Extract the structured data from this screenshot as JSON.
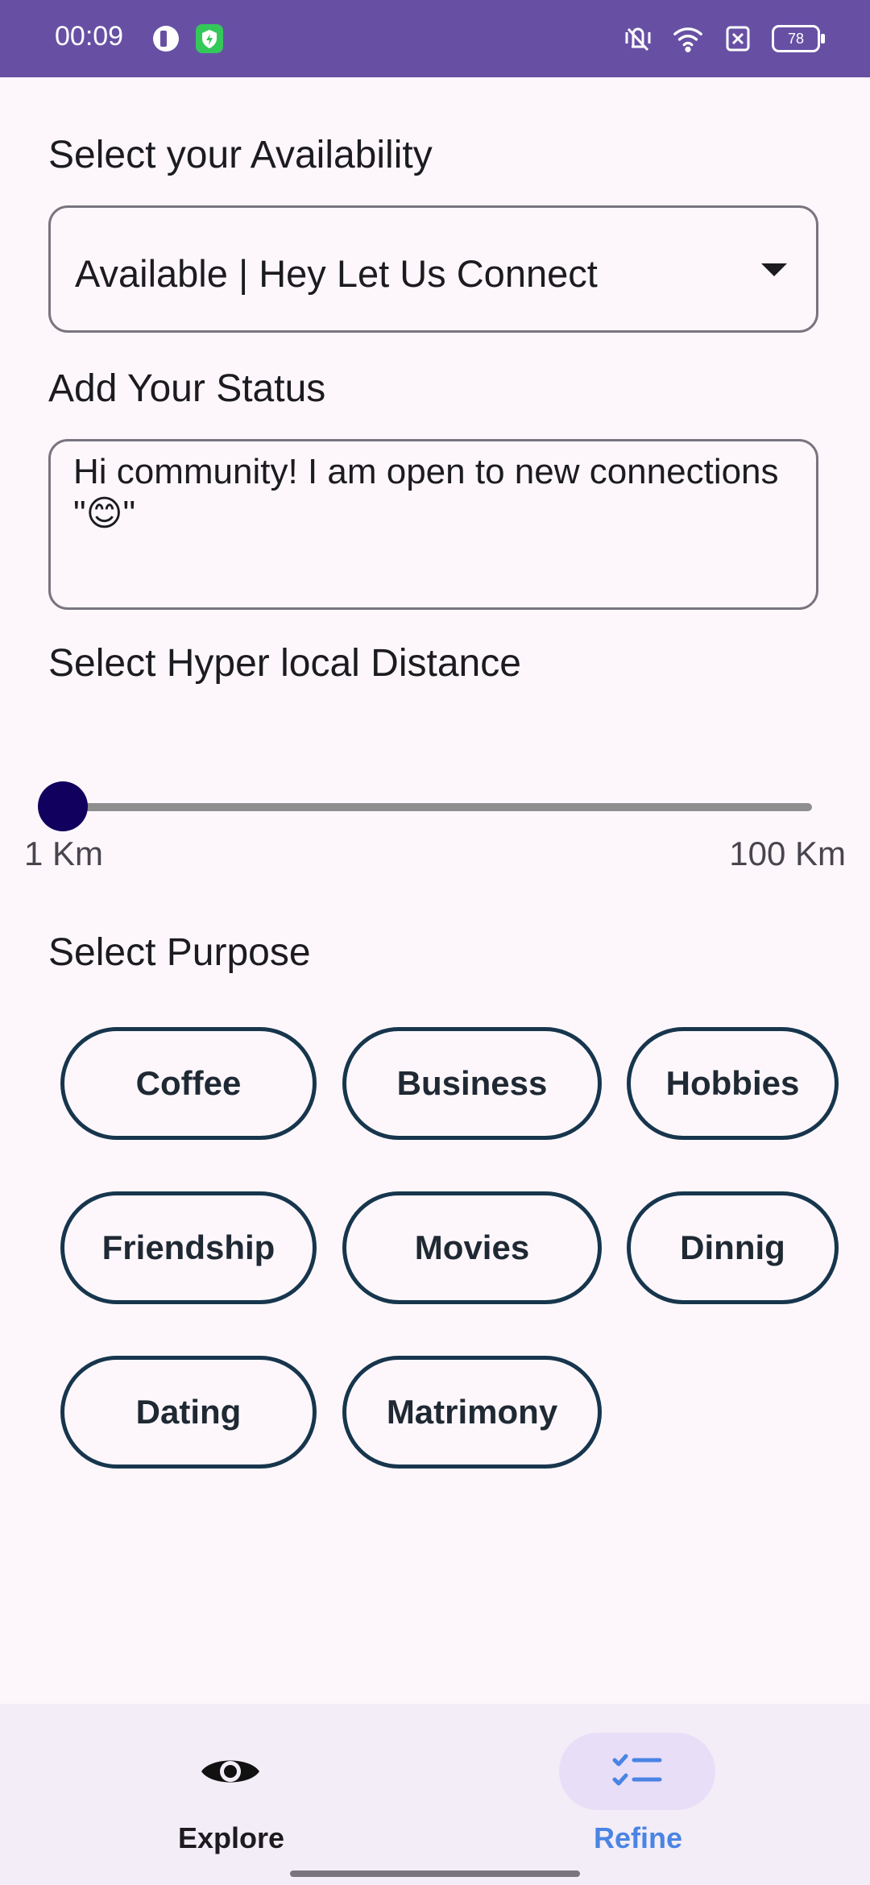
{
  "status_bar": {
    "time": "00:09",
    "battery": "78"
  },
  "form": {
    "availability_label": "Select your Availability",
    "availability_value": "Available | Hey Let Us Connect",
    "status_label": "Add Your Status",
    "status_value": "Hi community! I am open to new connections \"😊\"",
    "distance_label": "Select Hyper local Distance",
    "distance_min": "1 Km",
    "distance_max": "100 Km",
    "distance_value_fraction": 0.0,
    "purpose_label": "Select Purpose",
    "purposes": [
      "Coffee",
      "Business",
      "Hobbies",
      "Friendship",
      "Movies",
      "Dinnig",
      "Dating",
      "Matrimony"
    ]
  },
  "bottom_nav": {
    "items": [
      {
        "label": "Explore",
        "icon": "eye-icon",
        "selected": false
      },
      {
        "label": "Refine",
        "icon": "checklist-icon",
        "selected": true
      }
    ],
    "accent_color": "#4a84e4",
    "selected_pill_color": "#e8def8"
  },
  "colors": {
    "status_bar": "#6750a4",
    "background": "#fdf7fc",
    "chip_border": "#17364d",
    "slider_thumb": "#12005e"
  }
}
